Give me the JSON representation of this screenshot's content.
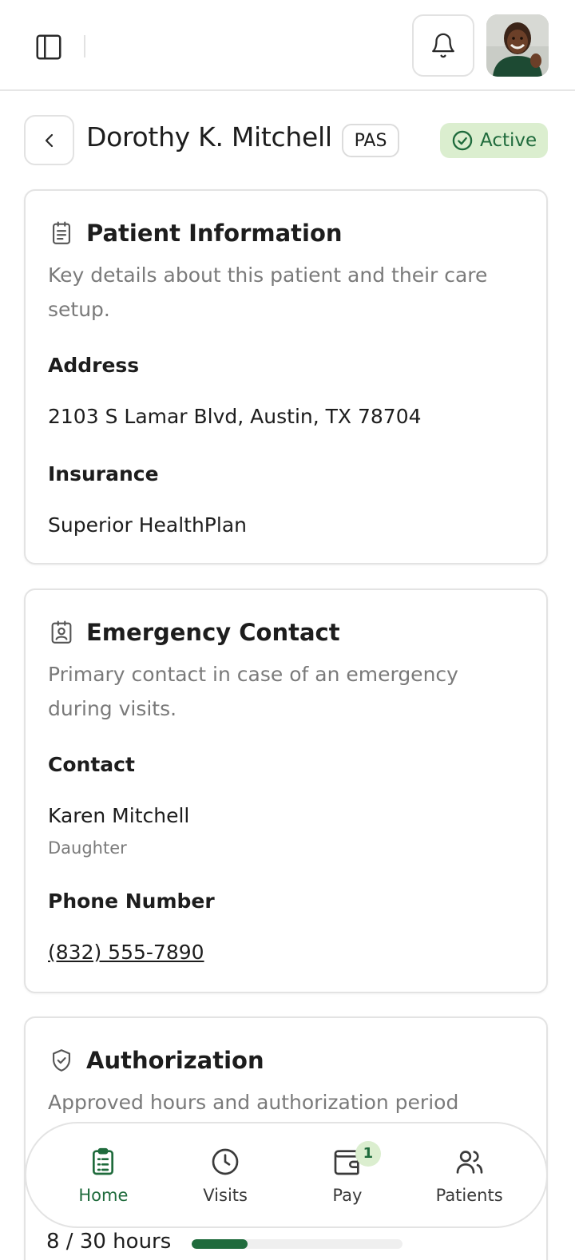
{
  "header": {
    "patient_name": "Dorothy K. Mitchell",
    "program_badge": "PAS",
    "status": "Active",
    "status_color": "#1f6b3c",
    "status_bg": "#dbeecf"
  },
  "icons": {
    "sidebar": "sidebar-toggle-icon",
    "bell": "bell-icon",
    "back": "chevron-left-icon",
    "status": "check-circle-icon",
    "patient_info": "clipboard-icon",
    "emergency": "contact-badge-icon",
    "authorization": "shield-check-icon"
  },
  "patient_info": {
    "title": "Patient Information",
    "description": "Key details about this patient and their care setup.",
    "address_label": "Address",
    "address": "2103 S Lamar Blvd, Austin, TX 78704",
    "insurance_label": "Insurance",
    "insurance": "Superior HealthPlan"
  },
  "emergency_contact": {
    "title": "Emergency Contact",
    "description": "Primary contact in case of an emergency during visits.",
    "contact_label": "Contact",
    "contact_name": "Karen Mitchell",
    "relation": "Daughter",
    "phone_label": "Phone Number",
    "phone": "(832) 555-7890"
  },
  "authorization": {
    "title": "Authorization",
    "description": "Approved hours and authorization period",
    "hours_text": "8 / 30 hours",
    "hours_used": 8,
    "hours_total": 30
  },
  "nav": {
    "items": [
      {
        "label": "Home",
        "icon": "clipboard-list-icon",
        "active": true
      },
      {
        "label": "Visits",
        "icon": "clock-icon",
        "active": false
      },
      {
        "label": "Pay",
        "icon": "wallet-icon",
        "active": false,
        "badge": "1"
      },
      {
        "label": "Patients",
        "icon": "users-icon",
        "active": false
      }
    ]
  },
  "accent_color": "#1f6b3c"
}
